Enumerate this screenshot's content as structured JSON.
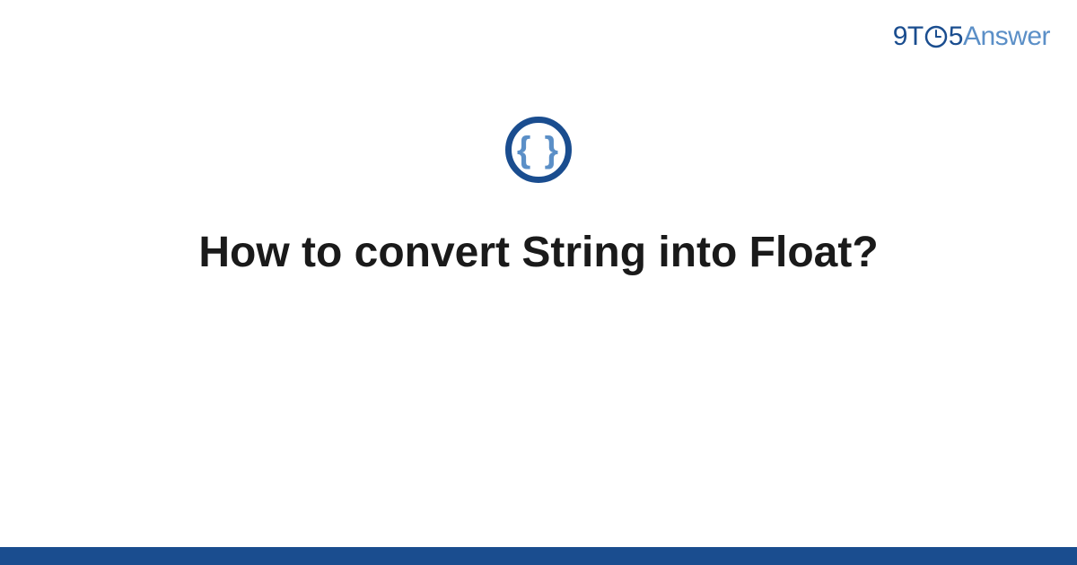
{
  "logo": {
    "part1": "9T",
    "part2": "5",
    "part3": "Answer"
  },
  "icon": {
    "braces": "{ }",
    "semantic": "code-braces"
  },
  "main": {
    "title": "How to convert String into Float?"
  },
  "colors": {
    "primary": "#1a4d8f",
    "secondary": "#5b8fc7",
    "text": "#1a1a1a",
    "background": "#ffffff"
  }
}
